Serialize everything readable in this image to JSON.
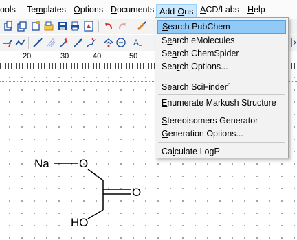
{
  "menubar": {
    "items": [
      {
        "text": "ools",
        "underline": ""
      },
      {
        "text": "Templates",
        "underline": "m"
      },
      {
        "text": "Options",
        "underline": "O"
      },
      {
        "text": "Documents",
        "underline": "D"
      },
      {
        "text": "Add-Ons",
        "underline": "O"
      },
      {
        "text": "ACD/Labs",
        "underline": "A"
      },
      {
        "text": "Help",
        "underline": "H"
      }
    ],
    "tools_label": "ools",
    "templates_label": "Templates",
    "options_label": "Options",
    "documents_label": "Documents",
    "addons_label": "Add-Ons",
    "acdlabs_label": "ACD/Labs",
    "help_label": "Help"
  },
  "toolbar1": {
    "icons": [
      "copy-icon",
      "paste-icon",
      "new-doc-icon",
      "open-icon",
      "save-icon",
      "print-icon",
      "pdf-icon",
      "undo-icon",
      "redo-icon",
      "clean-icon"
    ]
  },
  "toolbar2": {
    "icons": [
      "bond-tool-icon",
      "chain-tool-icon",
      "single-bond-icon",
      "multi-bond-icon",
      "radical-icon",
      "arrow-icon",
      "wavy-icon",
      "ring-icon",
      "charge-icon",
      "text-icon"
    ]
  },
  "ruler": {
    "labels": [
      "20",
      "30",
      "40",
      "50"
    ]
  },
  "canvas": {
    "atoms": {
      "na": "Na",
      "o1": "O",
      "o2": "O",
      "ho": "HO"
    }
  },
  "addons_menu": {
    "items": [
      {
        "label": "Search PubChem"
      },
      {
        "label": "Search eMolecules"
      },
      {
        "label": "Search ChemSpider"
      },
      {
        "label": "Search Options..."
      },
      {
        "label": "Search SciFinder"
      },
      {
        "label": "Enumerate Markush Structure"
      },
      {
        "label": "Stereoisomers Generator"
      },
      {
        "label": "Generation Options..."
      },
      {
        "label": "Calculate LogP"
      }
    ],
    "scifinder_superscript": "n",
    "highlighted_item": "Search PubChem"
  },
  "colors": {
    "menu_highlight": "#91c9f7",
    "menubar_open": "#cce8ff",
    "toolbar_bg": "#f3f3f3"
  }
}
